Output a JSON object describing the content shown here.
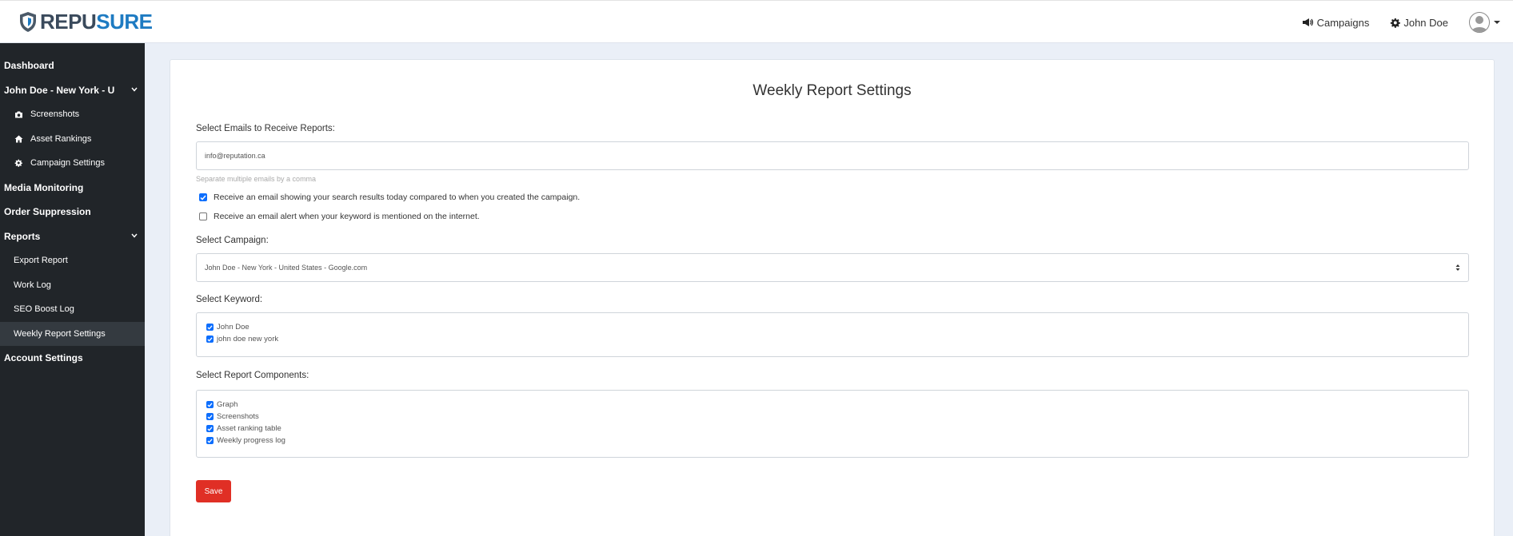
{
  "brand": {
    "name_part1": "REPU",
    "name_part2": "SURE",
    "accent": "#1e7bc2"
  },
  "topnav": {
    "campaigns_label": "Campaigns",
    "user_label": "John Doe"
  },
  "sidebar": {
    "items": [
      {
        "label": "Dashboard"
      },
      {
        "label": "John Doe - New York - U"
      },
      {
        "label": "Screenshots",
        "icon": "camera-icon"
      },
      {
        "label": "Asset Rankings",
        "icon": "home-icon"
      },
      {
        "label": "Campaign Settings",
        "icon": "gear-icon"
      },
      {
        "label": "Media Monitoring"
      },
      {
        "label": "Order Suppression"
      },
      {
        "label": "Reports"
      },
      {
        "label": "Export Report"
      },
      {
        "label": "Work Log"
      },
      {
        "label": "SEO Boost Log"
      },
      {
        "label": "Weekly Report Settings",
        "active": true
      },
      {
        "label": "Account Settings"
      }
    ]
  },
  "main": {
    "title": "Weekly Report Settings",
    "emails_label": "Select Emails to Receive Reports:",
    "emails_value": "info@reputation.ca",
    "emails_help": "Separate multiple emails by a comma",
    "options": [
      {
        "label": "Receive an email showing your search results today compared to when you created the campaign.",
        "checked": true
      },
      {
        "label": "Receive an email alert when your keyword is mentioned on the internet.",
        "checked": false
      }
    ],
    "campaign_label": "Select Campaign:",
    "campaign_value": "John Doe - New York - United States - Google.com",
    "keyword_label": "Select Keyword:",
    "keywords": [
      {
        "label": "John Doe",
        "checked": true
      },
      {
        "label": "john doe new york",
        "checked": true
      }
    ],
    "components_label": "Select Report Components:",
    "components": [
      {
        "label": "Graph",
        "checked": true
      },
      {
        "label": "Screenshots",
        "checked": true
      },
      {
        "label": "Asset ranking table",
        "checked": true
      },
      {
        "label": "Weekly progress log",
        "checked": true
      }
    ],
    "save_label": "Save"
  },
  "colors": {
    "sidebar_bg": "#212529",
    "sidebar_active": "#343a40",
    "page_bg": "#eaeff7",
    "save_button": "#e02f25",
    "checkbox": "#0d6efd"
  }
}
